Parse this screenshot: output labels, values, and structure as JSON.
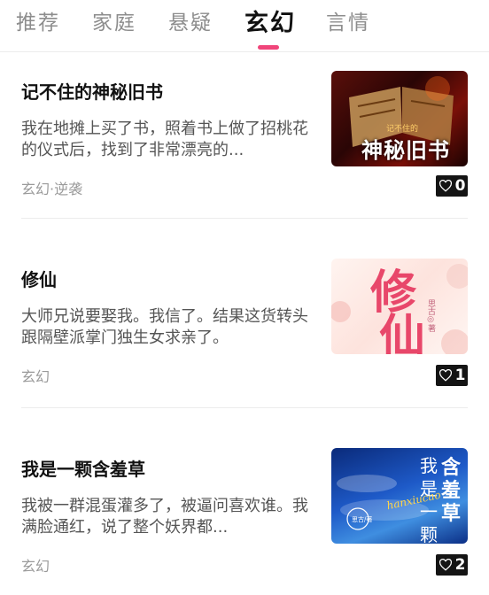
{
  "tabs": [
    {
      "label": "推荐"
    },
    {
      "label": "家庭"
    },
    {
      "label": "悬疑"
    },
    {
      "label": "玄幻",
      "active": true
    },
    {
      "label": "言情"
    }
  ],
  "accent_color": "#f0457a",
  "stories": [
    {
      "title": "记不住的神秘旧书",
      "description": "我在地摊上买了书，照着书上做了招桃花的仪式后，找到了非常漂亮的...",
      "tags": "玄幻·逆袭",
      "likes": "0",
      "cover_title": "神秘旧书",
      "cover_small": "记不住的"
    },
    {
      "title": "修仙",
      "description": "大师兄说要娶我。我信了。结果这货转头跟隔壁派掌门独生女求亲了。",
      "tags": "玄幻",
      "likes": "1",
      "cover_title_1": "修",
      "cover_title_2": "仙",
      "cover_author": "思古◎著"
    },
    {
      "title": "我是一颗含羞草",
      "description": "我被一群混蛋灌多了，被逼问喜欢谁。我满脸通红，说了整个妖界都...",
      "tags": "玄幻",
      "likes": "2",
      "cover_title_a": "我",
      "cover_title_b": "含",
      "cover_title_c": "是",
      "cover_title_d": "羞",
      "cover_title_e": "一",
      "cover_title_f": "草",
      "cover_title_g": "颗",
      "cover_pinyin": "hanxiucao",
      "cover_author": "思古/著"
    }
  ]
}
